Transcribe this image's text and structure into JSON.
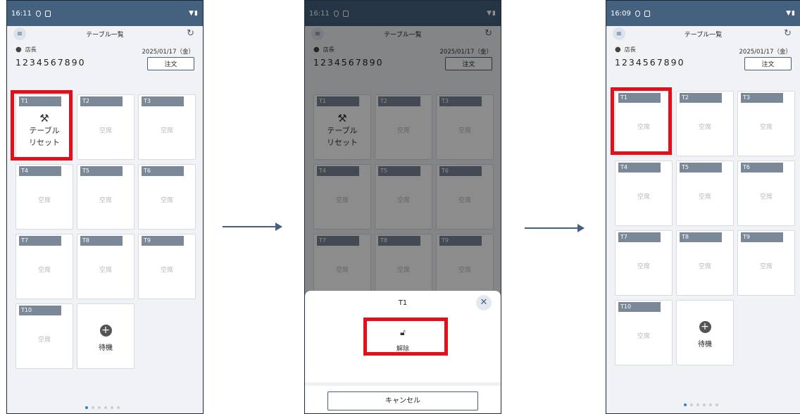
{
  "screens": [
    {
      "status": {
        "time": "16:11",
        "right": "▼▮"
      },
      "title": "テーブル一覧",
      "user": "店長",
      "date": "2025/01/17（金）",
      "code": "1234567890",
      "order_label": "注文",
      "tables": [
        {
          "tag": "T1",
          "reset_label": "テーブル\nリセット"
        },
        {
          "tag": "T2",
          "status": "空席"
        },
        {
          "tag": "T3",
          "status": "空席"
        },
        {
          "tag": "T4",
          "status": "空席"
        },
        {
          "tag": "T5",
          "status": "空席"
        },
        {
          "tag": "T6",
          "status": "空席"
        },
        {
          "tag": "T7",
          "status": "空席"
        },
        {
          "tag": "T8",
          "status": "空席"
        },
        {
          "tag": "T9",
          "status": "空席"
        },
        {
          "tag": "T10",
          "status": "空席"
        }
      ],
      "waiting_label": "待機"
    },
    {
      "status": {
        "time": "16:11",
        "right": "▼▮"
      },
      "title": "テーブル一覧",
      "user": "店長",
      "date": "2025/01/17（金）",
      "code": "1234567890",
      "order_label": "注文",
      "tables": [
        {
          "tag": "T1",
          "reset_label": "テーブル\nリセット"
        },
        {
          "tag": "T2",
          "status": "空席"
        },
        {
          "tag": "T3",
          "status": "空席"
        },
        {
          "tag": "T4",
          "status": "空席"
        },
        {
          "tag": "T5",
          "status": "空席"
        },
        {
          "tag": "T6",
          "status": "空席"
        },
        {
          "tag": "T7",
          "status": "空席"
        },
        {
          "tag": "T8",
          "status": "空席"
        },
        {
          "tag": "T9",
          "status": "空席"
        }
      ],
      "sheet": {
        "title": "T1",
        "unlock_label": "解除",
        "cancel_label": "キャンセル"
      }
    },
    {
      "status": {
        "time": "16:09",
        "right": "▼▮"
      },
      "title": "テーブル一覧",
      "user": "店長",
      "date": "2025/01/17（金）",
      "code": "1234567890",
      "order_label": "注文",
      "tables": [
        {
          "tag": "T1",
          "status": "空席"
        },
        {
          "tag": "T2",
          "status": "空席"
        },
        {
          "tag": "T3",
          "status": "空席"
        },
        {
          "tag": "T4",
          "status": "空席"
        },
        {
          "tag": "T5",
          "status": "空席"
        },
        {
          "tag": "T6",
          "status": "空席"
        },
        {
          "tag": "T7",
          "status": "空席"
        },
        {
          "tag": "T8",
          "status": "空席"
        },
        {
          "tag": "T9",
          "status": "空席"
        },
        {
          "tag": "T10",
          "status": "空席"
        }
      ],
      "waiting_label": "待機"
    }
  ],
  "colors": {
    "header": "#44617f",
    "highlight": "#e2101a",
    "tag": "#7a8898",
    "active_dot": "#2f80d6"
  },
  "icons": [
    "menu-icon",
    "refresh-icon",
    "person-icon",
    "broom-icon",
    "plus-icon",
    "unlock-icon",
    "close-icon",
    "shield-icon",
    "battery-icon",
    "wifi-icon"
  ]
}
